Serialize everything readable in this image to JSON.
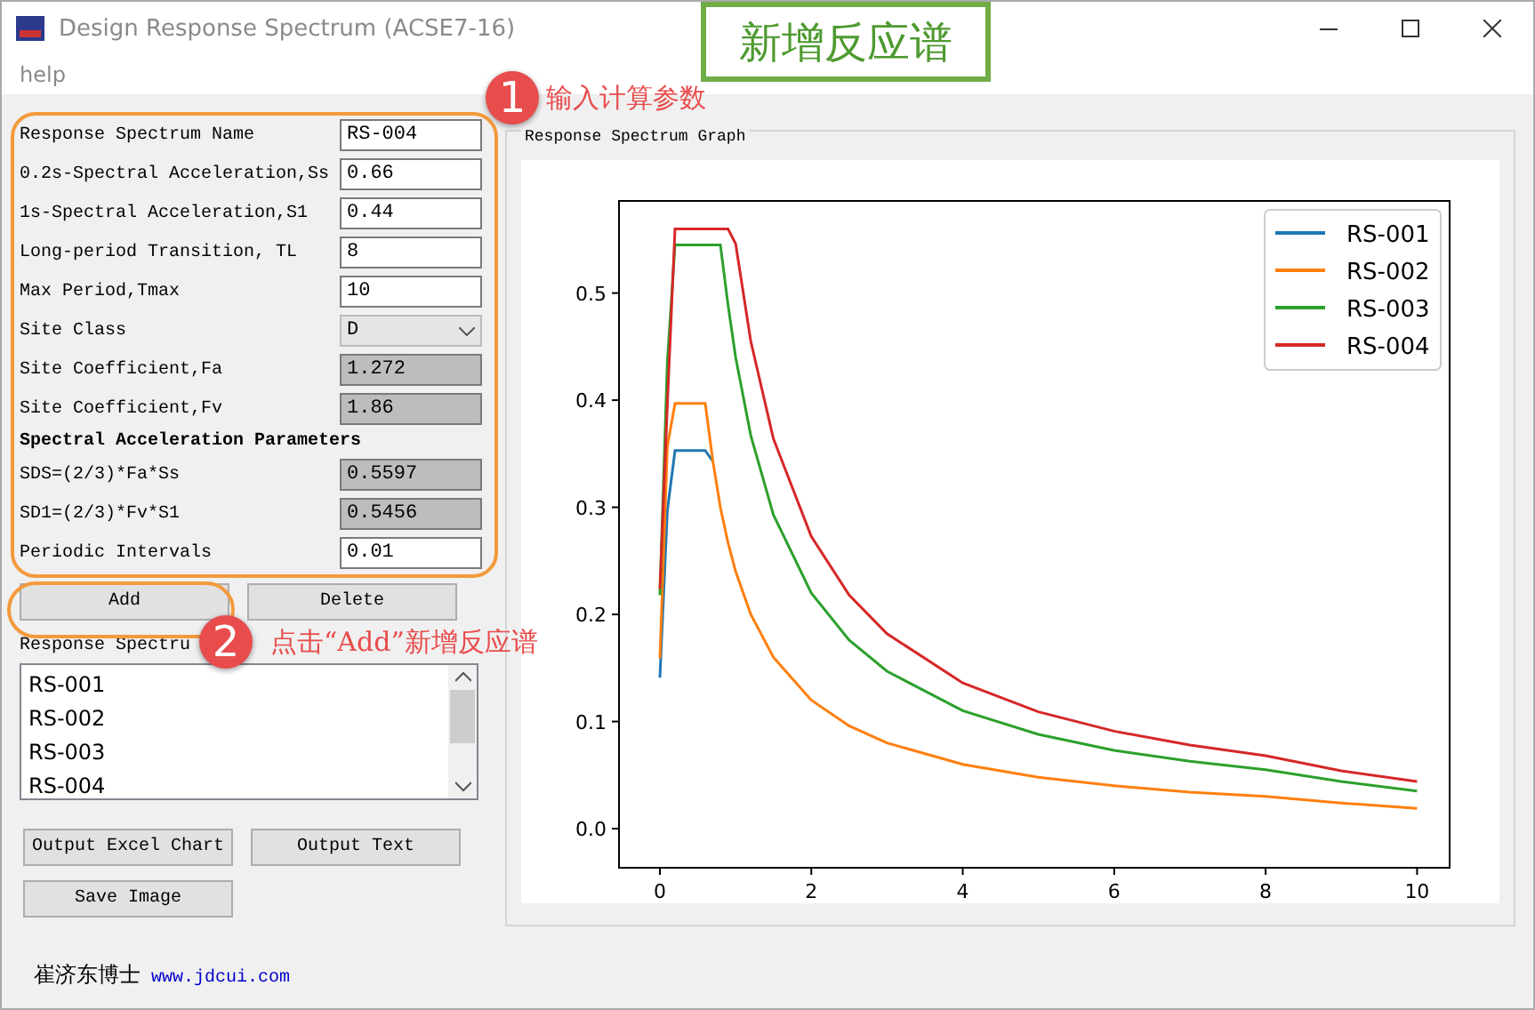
{
  "window": {
    "title": "Design Response Spectrum  (ACSE7-16)"
  },
  "menu": [
    "help"
  ],
  "form": {
    "fields": [
      {
        "kind": "input",
        "label": "Response Spectrum Name",
        "value": "RS-004"
      },
      {
        "kind": "input",
        "label": "0.2s-Spectral Acceleration,Ss",
        "value": "0.66"
      },
      {
        "kind": "input",
        "label": "1s-Spectral Acceleration,S1",
        "value": "0.44"
      },
      {
        "kind": "input",
        "label": "Long-period Transition, TL",
        "value": "8"
      },
      {
        "kind": "input",
        "label": "Max Period,Tmax",
        "value": "10"
      },
      {
        "kind": "select",
        "label": "Site Class",
        "value": "D"
      },
      {
        "kind": "readonly",
        "label": "Site Coefficient,Fa",
        "value": "1.272"
      },
      {
        "kind": "readonly",
        "label": "Site Coefficient,Fv",
        "value": "1.86"
      },
      {
        "kind": "heading",
        "label": "Spectral Acceleration Parameters"
      },
      {
        "kind": "readonly",
        "label": "SDS=(2/3)*Fa*Ss",
        "value": "0.5597"
      },
      {
        "kind": "readonly",
        "label": "SD1=(2/3)*Fv*S1",
        "value": "0.5456"
      },
      {
        "kind": "input",
        "label": "Periodic Intervals",
        "value": "0.01"
      }
    ]
  },
  "actions": [
    "Add",
    "Delete"
  ],
  "list": {
    "label": "Response Spectru",
    "items": [
      "RS-001",
      "RS-002",
      "RS-003",
      "RS-004"
    ]
  },
  "outputs": [
    "Output Excel Chart",
    "Output Text",
    "Save Image"
  ],
  "footer": {
    "author": "崔济东博士",
    "link": "www.jdcui.com"
  },
  "graph": {
    "title": "Response Spectrum Graph",
    "chart_data": {
      "type": "line",
      "legend": true,
      "x": [
        0,
        0.05,
        0.1,
        0.2,
        0.3,
        0.4,
        0.5,
        0.6,
        0.7,
        0.8,
        0.9,
        1,
        1.2,
        1.5,
        2,
        2.5,
        3,
        4,
        5,
        6,
        7,
        8,
        9,
        10
      ],
      "xlim": [
        -0.54,
        10.43
      ],
      "ylim": [
        -0.0365,
        0.586
      ],
      "xticks": [
        {
          "value": 0,
          "label": "0"
        },
        {
          "value": 2,
          "label": "2"
        },
        {
          "value": 4,
          "label": "4"
        },
        {
          "value": 6,
          "label": "6"
        },
        {
          "value": 8,
          "label": "8"
        },
        {
          "value": 10,
          "label": "10"
        }
      ],
      "yticks": [
        {
          "value": 0,
          "label": "0.0"
        },
        0.1,
        0.2,
        0.3,
        0.4,
        0.5
      ],
      "series": [
        {
          "name": "RS-001",
          "color": "#1f77b4",
          "values": [
            0.141,
            0.219,
            0.297,
            0.353,
            0.353,
            0.353,
            0.353,
            0.353,
            0.343,
            null,
            null,
            null,
            null,
            null,
            null,
            null,
            null,
            null,
            null,
            null,
            null,
            null,
            null,
            null
          ]
        },
        {
          "name": "RS-002",
          "color": "#ff7f0e",
          "values": [
            0.159,
            0.258,
            0.357,
            0.397,
            0.397,
            0.397,
            0.397,
            0.397,
            0.343,
            0.3,
            0.267,
            0.24,
            0.2,
            0.16,
            0.12,
            0.096,
            0.08,
            0.06,
            0.048,
            0.04,
            0.034,
            0.03,
            0.024,
            0.019
          ]
        },
        {
          "name": "RS-003",
          "color": "#2ca02c",
          "values": [
            0.218,
            0.327,
            0.436,
            0.545,
            0.545,
            0.545,
            0.545,
            0.545,
            0.545,
            0.545,
            0.489,
            0.44,
            0.367,
            0.293,
            0.22,
            0.176,
            0.147,
            0.11,
            0.088,
            0.073,
            0.063,
            0.055,
            0.044,
            0.035
          ]
        },
        {
          "name": "RS-004",
          "color": "#d62728",
          "values": [
            0.224,
            0.31,
            0.396,
            0.56,
            0.56,
            0.56,
            0.56,
            0.56,
            0.56,
            0.56,
            0.56,
            0.546,
            0.455,
            0.364,
            0.273,
            0.218,
            0.182,
            0.136,
            0.109,
            0.091,
            0.078,
            0.068,
            0.054,
            0.044
          ]
        }
      ]
    }
  },
  "banner": "新增反应谱",
  "callouts": [
    {
      "number": "1",
      "text": "输入计算参数"
    },
    {
      "number": "2",
      "text": "点击“Add”新增反应谱"
    }
  ]
}
